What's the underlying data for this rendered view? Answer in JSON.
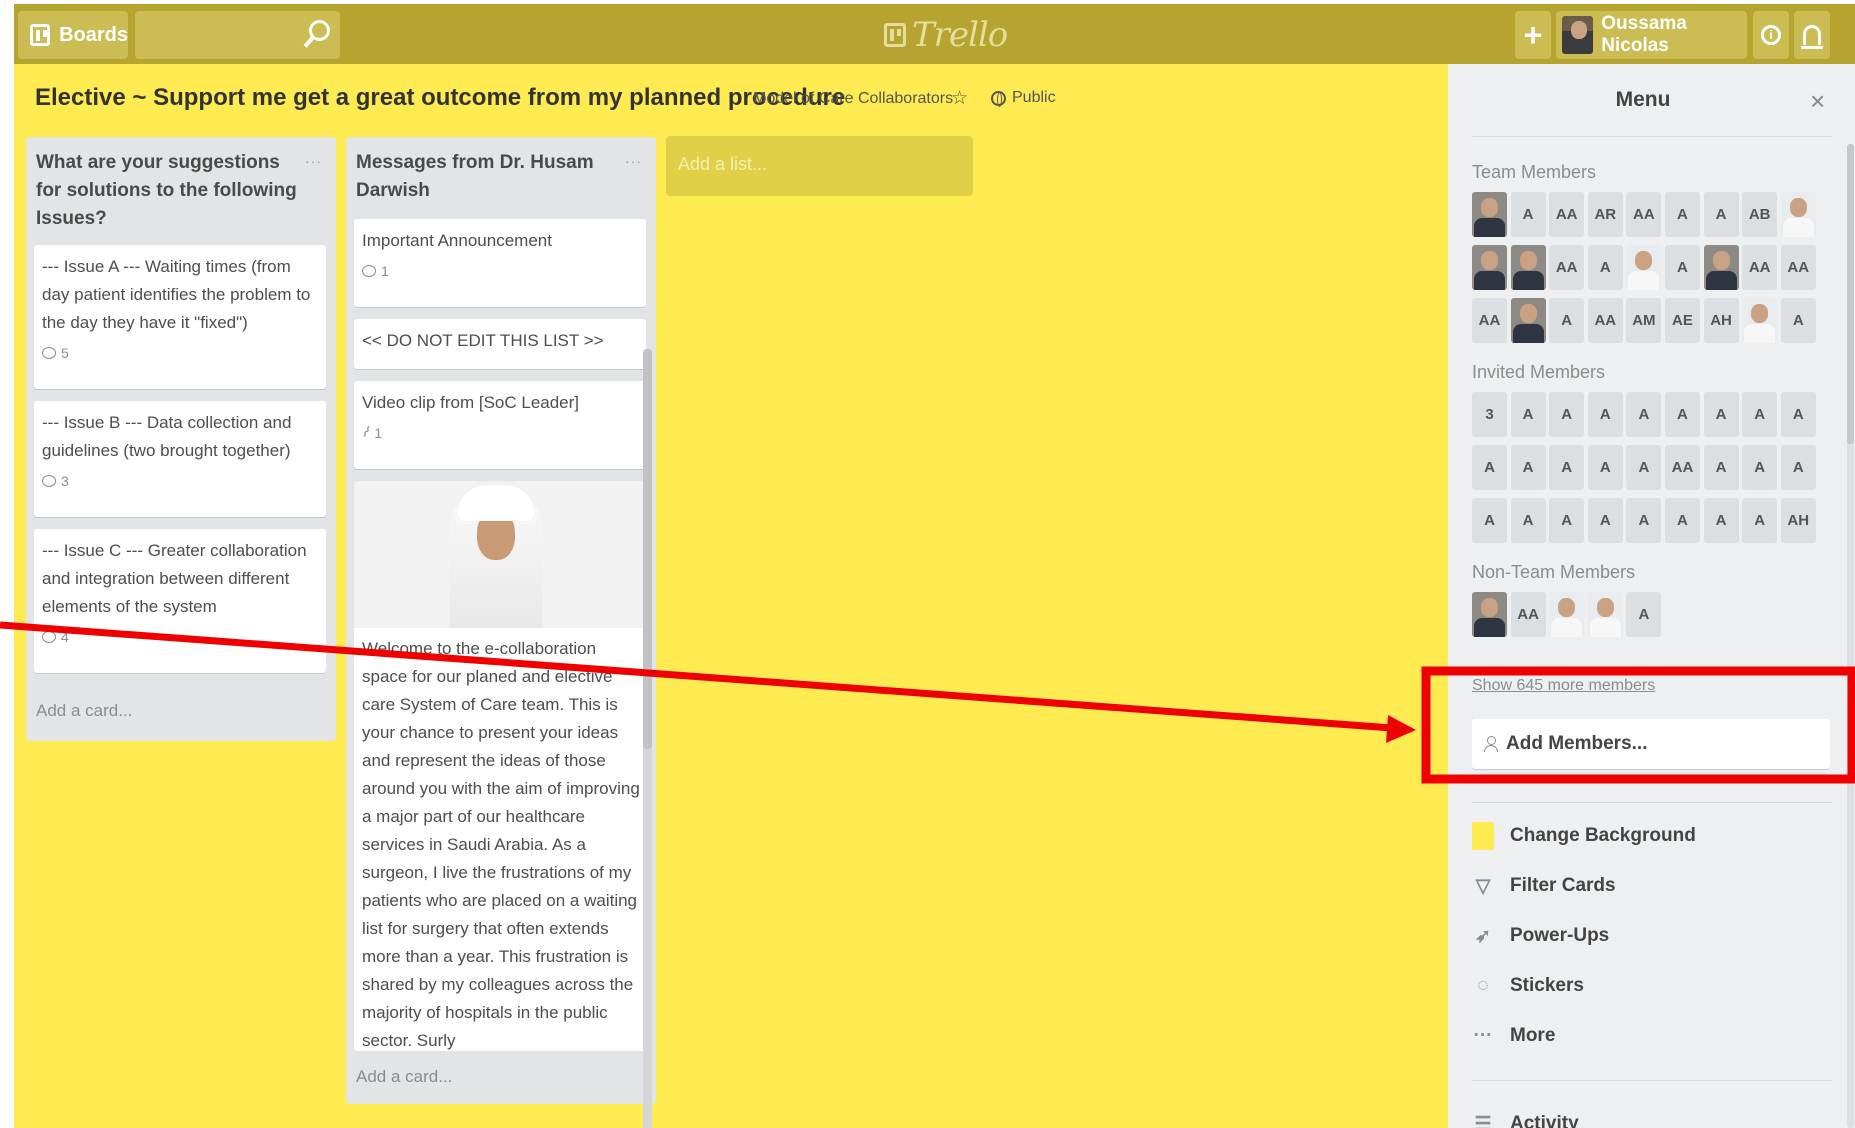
{
  "header": {
    "boards_label": "Boards",
    "search_placeholder": "",
    "logo_text": "Trello",
    "add_label": "+",
    "user_name": "Oussama Nicolas",
    "info_label": "i"
  },
  "board": {
    "title": "Elective ~ Support me get a great outcome from my planned procedure",
    "team": "Model of Care Collaborators",
    "star": "☆",
    "visibility": "Public"
  },
  "lists": [
    {
      "title": "What are your suggestions for solutions to the following Issues?",
      "menu": "···",
      "cards": [
        {
          "text": "--- Issue A --- Waiting times (from day patient identifies the problem to the day they have it \"fixed\")",
          "comments": "5"
        },
        {
          "text": "--- Issue B --- Data collection and guidelines (two brought together)",
          "comments": "3"
        },
        {
          "text": "--- Issue C --- Greater collaboration and integration between different elements of the system",
          "comments": "4"
        }
      ],
      "add_card": "Add a card..."
    },
    {
      "title": "Messages from Dr. Husam Darwish",
      "menu": "···",
      "cards": [
        {
          "text": "Important Announcement",
          "comments": "1"
        },
        {
          "text": "<< DO NOT EDIT THIS LIST >>"
        },
        {
          "text": "Video clip from [SoC Leader]",
          "attachments": "1"
        },
        {
          "text": "Welcome to the e-collaboration space for our planed and elective care System of Care team. This is your chance to present your ideas and represent the ideas of those around you with the aim of improving a major part of our healthcare services in Saudi Arabia. As a surgeon, I live the frustrations of my patients who are placed on a waiting list for surgery that often extends more than a year. This frustration is shared by my colleagues across the majority of hospitals in the public sector. Surly"
        }
      ],
      "add_card": "Add a card..."
    }
  ],
  "add_list": "Add a list...",
  "sidebar": {
    "title": "Menu",
    "close": "×",
    "team_members_title": "Team Members",
    "team_members": [
      {
        "photo": true
      },
      {
        "initials": "A"
      },
      {
        "initials": "AA"
      },
      {
        "initials": "AR"
      },
      {
        "initials": "AA"
      },
      {
        "initials": "A"
      },
      {
        "initials": "A"
      },
      {
        "initials": "AB"
      },
      {
        "photo": true,
        "light": true
      },
      {
        "photo": true
      },
      {
        "photo": true
      },
      {
        "initials": "AA"
      },
      {
        "initials": "A"
      },
      {
        "photo": true,
        "light": true
      },
      {
        "initials": "A"
      },
      {
        "photo": true
      },
      {
        "initials": "AA"
      },
      {
        "initials": "AA"
      },
      {
        "initials": "AA"
      },
      {
        "photo": true
      },
      {
        "initials": "A"
      },
      {
        "initials": "AA"
      },
      {
        "initials": "AM"
      },
      {
        "initials": "AE"
      },
      {
        "initials": "AH"
      },
      {
        "photo": true,
        "light": true
      },
      {
        "initials": "A"
      }
    ],
    "invited_members_title": "Invited Members",
    "invited_members": [
      "3",
      "A",
      "A",
      "A",
      "A",
      "A",
      "A",
      "A",
      "A",
      "A",
      "A",
      "A",
      "A",
      "A",
      "AA",
      "A",
      "A",
      "A",
      "A",
      "A",
      "A",
      "A",
      "A",
      "A",
      "A",
      "A",
      "AH"
    ],
    "non_team_title": "Non-Team Members",
    "non_team_members": [
      {
        "photo": true
      },
      {
        "initials": "AA"
      },
      {
        "photo": true,
        "light": true
      },
      {
        "photo": true,
        "light": true
      },
      {
        "initials": "A"
      }
    ],
    "show_more": "Show 645 more members",
    "add_members": "Add Members...",
    "menu_items": [
      {
        "label": "Change Background",
        "icon": "background-swatch"
      },
      {
        "label": "Filter Cards",
        "icon": "filter-icon"
      },
      {
        "label": "Power-Ups",
        "icon": "rocket-icon"
      },
      {
        "label": "Stickers",
        "icon": "sticker-icon"
      },
      {
        "label": "More",
        "icon": "more-icon"
      }
    ],
    "activity": "Activity"
  },
  "colors": {
    "header": "#b5a42f",
    "board_bg": "#fdeb51",
    "annotation": "#ee0000"
  }
}
